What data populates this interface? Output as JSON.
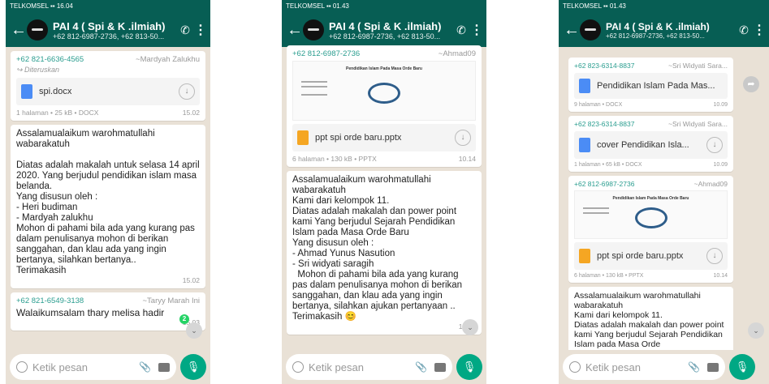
{
  "status": [
    "TELKOMSEL ▪▪ 16.04 ",
    "TELKOMSEL ▪▪ 01.43",
    "TELKOMSEL ▪▪ 01.43"
  ],
  "group": {
    "title": "PAI 4 ( Spi & K .ilmiah)",
    "subtitle": "+62 812-6987-2736, +62 813-50..."
  },
  "input": {
    "placeholder": "Ketik pesan"
  },
  "screen1": {
    "doc_msg": {
      "phone": "+62 821-6636-4565",
      "name": "~Mardyah Zalukhu",
      "forwarded": "Diteruskan",
      "file": "spi.docx",
      "meta": "1 halaman • 25 kB • DOCX",
      "time": "15.02"
    },
    "text_msg": {
      "text": "Assalamualaikum warohmatullahi wabarakatuh\n\nDiatas adalah makalah untuk selasa 14 april 2020. Yang berjudul pendidikan islam masa belanda.\nYang disusun oleh :\n- Heri budiman\n- Mardyah zalukhu\nMohon di pahami bila ada yang kurang pas dalam penulisanya mohon di berikan sanggahan, dan klau ada yang ingin bertanya, silahkan bertanya..\nTerimakasih",
      "time": "15.02"
    },
    "reply_msg": {
      "phone": "+62 821-6549-3138",
      "name": "~Taryy Marah Ini",
      "text": "Walaikumsalam thary melisa hadir",
      "time": "15.03"
    },
    "unread_badge": "2"
  },
  "screen2": {
    "ppt_msg": {
      "phone": "+62 812-6987-2736",
      "name": "~Ahmad09",
      "preview_title": "Pendidikan Islam Pada Masa Orde Baru",
      "file": "ppt spi orde baru.pptx",
      "meta": "6 halaman • 130 kB • PPTX",
      "time": "10.14"
    },
    "text_msg": {
      "text": "Assalamualaikum warohmatullahi wabarakatuh\nKami dari kelompok 11.\nDiatas adalah makalah dan power point kami Yang berjudul Sejarah Pendidikan Islam pada Masa Orde Baru\nYang disusun oleh :\n- Ahmad Yunus Nasution\n- Sri widyati saragih\n  Mohon di pahami bila ada yang kurang pas dalam penulisanya mohon di berikan sanggahan, dan klau ada yang ingin bertanya, silahkan ajukan pertanyaan ..\nTerimakasih 😊",
      "time": "10.15"
    }
  },
  "screen3": {
    "doc1": {
      "phone": "+62 823-6314-8837",
      "name": "~Sri Widyati Sara...",
      "file": "Pendidikan Islam Pada Mas...",
      "meta": "9 halaman • DOCX",
      "time": "10.09"
    },
    "doc2": {
      "phone": "+62 823-6314-8837",
      "name": "~Sri Widyati Sara...",
      "file": "cover Pendidikan Isla...",
      "meta": "1 halaman • 65 kB • DOCX",
      "time": "10.09"
    },
    "ppt_msg": {
      "phone": "+62 812-6987-2736",
      "name": "~Ahmad09",
      "preview_title": "Pendidikan Islam Pada Masa Orde Baru",
      "file": "ppt spi orde baru.pptx",
      "meta": "6 halaman • 130 kB • PPTX",
      "time": "10.14"
    },
    "text_msg": {
      "text": "Assalamualaikum warohmatullahi wabarakatuh\nKami dari kelompok 11.\nDiatas adalah makalah dan power point kami Yang berjudul Sejarah Pendidikan Islam pada Masa Orde"
    }
  }
}
